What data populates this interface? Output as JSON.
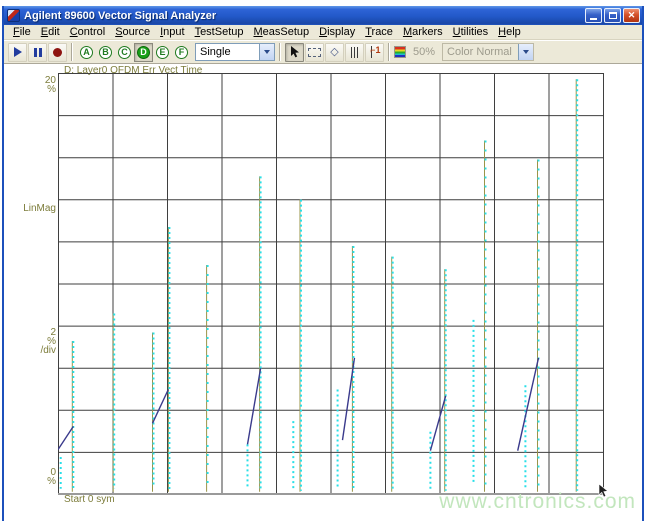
{
  "window": {
    "title": "Agilent 89600 Vector Signal Analyzer",
    "controls": [
      "minimize",
      "maximize",
      "close"
    ]
  },
  "menu": {
    "items": [
      "File",
      "Edit",
      "Control",
      "Source",
      "Input",
      "TestSetup",
      "MeasSetup",
      "Display",
      "Trace",
      "Markers",
      "Utilities",
      "Help"
    ]
  },
  "toolbar": {
    "transport": [
      "play",
      "pause",
      "record"
    ],
    "measurements": [
      "A",
      "B",
      "C",
      "D",
      "E",
      "F"
    ],
    "active_measurement": "D",
    "sweep_mode": "Single",
    "tools": [
      "select-arrow-icon",
      "zoom-box-icon",
      "diamond-marker-icon",
      "band-lines-icon",
      "offset-marker-icon"
    ],
    "active_tool": "select-arrow-icon",
    "palette_icon": "color-palette-icon",
    "zoom_percent": "50%",
    "color_mode": "Color Normal"
  },
  "watermark": "www.cntronics.com",
  "chart_data": {
    "type": "scatter",
    "title": "D: Layer0 OFDM Err Vect Time",
    "ylabel": "LinMag",
    "y_top_label": "20",
    "y_unit": "%",
    "y_scale_value": "2",
    "y_scale_suffix": "/div",
    "y_bottom_label": "0",
    "x_start_label": "Start 0 sym",
    "ylim": [
      0,
      20
    ],
    "grid": {
      "x_divs": 10,
      "y_divs": 10,
      "grid_on": true
    },
    "colors": {
      "dots": "#28dfe8",
      "spikes": "#9a9448",
      "trace": "#3a3a8c",
      "grid": "#3f3f3f",
      "axis": "#9a9a9a",
      "labels": "#7c7c3a"
    },
    "dot_columns": [
      {
        "x": 0.005,
        "top": 1.8,
        "bottom": 0.3
      },
      {
        "x": 0.028,
        "top": 7.3,
        "bottom": 0.3
      },
      {
        "x": 0.103,
        "top": 8.6,
        "bottom": 0.3
      },
      {
        "x": 0.175,
        "top": 7.7,
        "bottom": 0.4
      },
      {
        "x": 0.204,
        "top": 12.7,
        "bottom": 0.2
      },
      {
        "x": 0.274,
        "top": 10.9,
        "bottom": 0.3,
        "sparse": true
      },
      {
        "x": 0.347,
        "top": 2.4,
        "bottom": 0.3
      },
      {
        "x": 0.371,
        "top": 15.1,
        "bottom": 0.2
      },
      {
        "x": 0.431,
        "top": 3.5,
        "bottom": 0.3
      },
      {
        "x": 0.445,
        "top": 14.0,
        "bottom": 0.2
      },
      {
        "x": 0.512,
        "top": 5.0,
        "bottom": 0.3
      },
      {
        "x": 0.541,
        "top": 11.8,
        "bottom": 0.2
      },
      {
        "x": 0.613,
        "top": 11.3,
        "bottom": 0.3
      },
      {
        "x": 0.682,
        "top": 3.0,
        "bottom": 0.3
      },
      {
        "x": 0.71,
        "top": 10.7,
        "bottom": 0.2
      },
      {
        "x": 0.761,
        "top": 8.3,
        "bottom": 0.5
      },
      {
        "x": 0.783,
        "top": 16.8,
        "bottom": 0.2,
        "sparse": true
      },
      {
        "x": 0.856,
        "top": 5.2,
        "bottom": 0.3
      },
      {
        "x": 0.88,
        "top": 15.9,
        "bottom": 0.2,
        "sparse": true
      },
      {
        "x": 0.951,
        "top": 19.7,
        "bottom": 0.2
      }
    ],
    "spikes": [
      {
        "x": 0.028,
        "top": 7.3
      },
      {
        "x": 0.103,
        "top": 8.6
      },
      {
        "x": 0.175,
        "top": 7.7
      },
      {
        "x": 0.204,
        "top": 12.7
      },
      {
        "x": 0.274,
        "top": 10.9
      },
      {
        "x": 0.371,
        "top": 15.1
      },
      {
        "x": 0.445,
        "top": 14.0
      },
      {
        "x": 0.541,
        "top": 11.8
      },
      {
        "x": 0.613,
        "top": 11.3
      },
      {
        "x": 0.71,
        "top": 10.7
      },
      {
        "x": 0.783,
        "top": 16.8
      },
      {
        "x": 0.88,
        "top": 15.9
      },
      {
        "x": 0.951,
        "top": 19.7
      }
    ],
    "trace_segments": [
      {
        "x1": 0.0,
        "y1": 2.15,
        "x2": 0.028,
        "y2": 3.25
      },
      {
        "x1": 0.173,
        "y1": 3.4,
        "x2": 0.202,
        "y2": 5.0
      },
      {
        "x1": 0.347,
        "y1": 2.4,
        "x2": 0.371,
        "y2": 6.0
      },
      {
        "x1": 0.521,
        "y1": 2.6,
        "x2": 0.543,
        "y2": 6.5
      },
      {
        "x1": 0.682,
        "y1": 2.1,
        "x2": 0.71,
        "y2": 4.7
      },
      {
        "x1": 0.842,
        "y1": 2.1,
        "x2": 0.88,
        "y2": 6.5
      }
    ]
  }
}
